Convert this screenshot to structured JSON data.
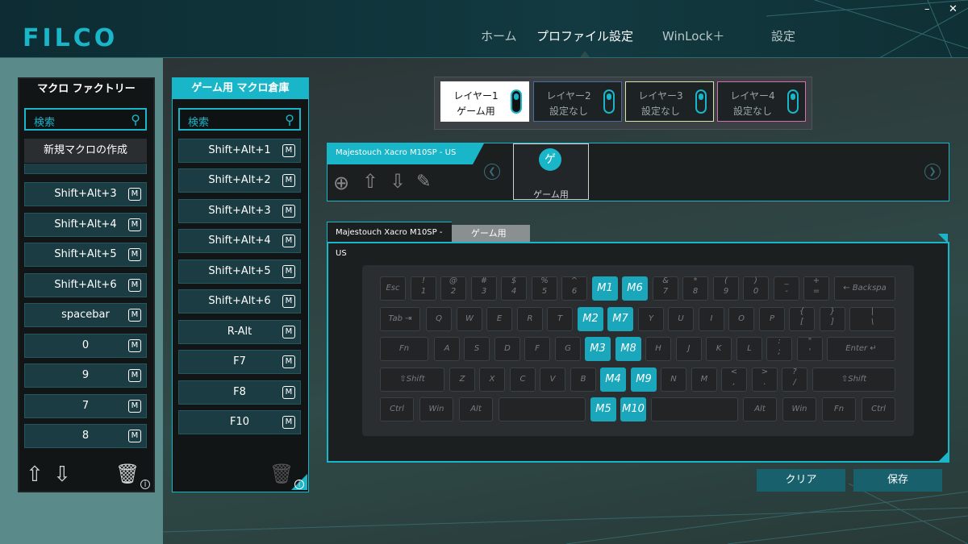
{
  "app": {
    "logo": "FILCO"
  },
  "nav": {
    "home": "ホーム",
    "profile": "プロファイル設定",
    "winlock": "WinLock＋",
    "settings": "設定"
  },
  "window": {
    "minimize": "–",
    "close": "✕"
  },
  "macro_factory": {
    "title": "マクロ ファクトリー",
    "search_placeholder": "検索",
    "create_button": "新規マクロの作成",
    "items": [
      "Shift+Alt+3",
      "Shift+Alt+4",
      "Shift+Alt+5",
      "Shift+Alt+6",
      "spacebar",
      "0",
      "9",
      "7",
      "8"
    ],
    "m_badge": "M"
  },
  "game_macro": {
    "title": "ゲーム用 マクロ倉庫",
    "search_placeholder": "検索",
    "items": [
      "Shift+Alt+1",
      "Shift+Alt+2",
      "Shift+Alt+3",
      "Shift+Alt+4",
      "Shift+Alt+5",
      "Shift+Alt+6",
      "R-Alt",
      "F7",
      "F8",
      "F10"
    ],
    "m_badge": "M"
  },
  "layers": [
    {
      "title": "レイヤー1",
      "sub": "ゲーム用"
    },
    {
      "title": "レイヤー2",
      "sub": "設定なし"
    },
    {
      "title": "レイヤー3",
      "sub": "設定なし"
    },
    {
      "title": "レイヤー4",
      "sub": "設定なし"
    }
  ],
  "profile": {
    "device": "Majestouch Xacro M10SP - US",
    "card_glyph": "ゲ",
    "card_label": "ゲーム用"
  },
  "keyboard": {
    "device_tab": "Majestouch Xacro M10SP - US",
    "profile_tab": "ゲーム用"
  },
  "buttons": {
    "clear": "クリア",
    "save": "保存"
  },
  "colors": {
    "accent": "#19b5c8",
    "macro_key": "#1aa6bb",
    "layer3": "#d7e6a8",
    "layer4": "#d46fb3"
  }
}
